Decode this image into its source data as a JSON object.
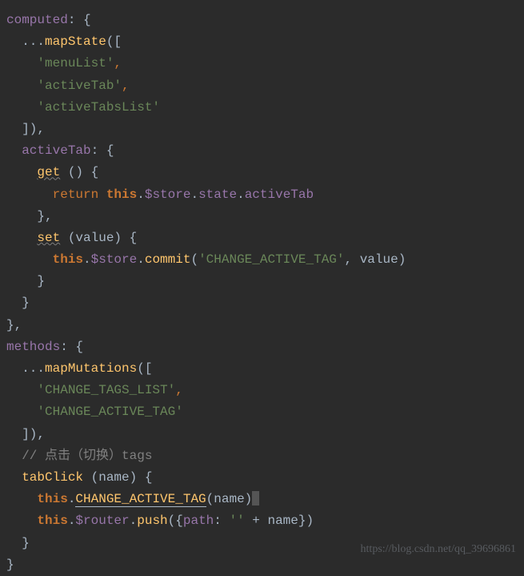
{
  "code": {
    "l1_computed": "computed",
    "l1_colon_brace": ": {",
    "l2_spread": "  ...",
    "l2_mapState": "mapState",
    "l2_open": "([",
    "l3_indent": "    ",
    "l3_str": "'menuList'",
    "l3_comma": ",",
    "l4_indent": "    ",
    "l4_str": "'activeTab'",
    "l4_comma": ",",
    "l5_indent": "    ",
    "l5_str": "'activeTabsList'",
    "l6_close": "  ]),",
    "l7_indent": "  ",
    "l7_activeTab": "activeTab",
    "l7_colon_brace": ": {",
    "l8_indent": "    ",
    "l8_get": "get",
    "l8_params": " () {",
    "l9_indent": "      ",
    "l9_return": "return ",
    "l9_this": "this",
    "l9_dot1": ".",
    "l9_store": "$store",
    "l9_dot2": ".",
    "l9_state": "state",
    "l9_dot3": ".",
    "l9_active": "activeTab",
    "l10_close": "    },",
    "l11_indent": "    ",
    "l11_set": "set",
    "l11_params": " (value) {",
    "l12_indent": "      ",
    "l12_this": "this",
    "l12_dot1": ".",
    "l12_store": "$store",
    "l12_dot2": ".",
    "l12_commit": "commit",
    "l12_open": "(",
    "l12_str": "'CHANGE_ACTIVE_TAG'",
    "l12_rest": ", value)",
    "l13_close": "    }",
    "l14_close": "  }",
    "l15_close": "},",
    "l16_methods": "methods",
    "l16_colon_brace": ": {",
    "l17_spread": "  ...",
    "l17_mapMutations": "mapMutations",
    "l17_open": "([",
    "l18_indent": "    ",
    "l18_str": "'CHANGE_TAGS_LIST'",
    "l18_comma": ",",
    "l19_indent": "    ",
    "l19_str": "'CHANGE_ACTIVE_TAG'",
    "l20_close": "  ]),",
    "l21_indent": "  ",
    "l21_comment": "// 点击（切换）tags",
    "l22_indent": "  ",
    "l22_tabClick": "tabClick",
    "l22_params": " (name) {",
    "l23_indent": "    ",
    "l23_this": "this",
    "l23_dot": ".",
    "l23_change": "CHANGE_ACTIVE_TAG",
    "l23_call": "(name)",
    "l24_indent": "    ",
    "l24_this": "this",
    "l24_dot1": ".",
    "l24_router": "$router",
    "l24_dot2": ".",
    "l24_push": "push",
    "l24_open": "({",
    "l24_path": "path",
    "l24_colon": ": ",
    "l24_str": "''",
    "l24_rest": " + name})",
    "l25_close": "  }",
    "l26_close": "}"
  },
  "watermark": "https://blog.csdn.net/qq_39696861"
}
